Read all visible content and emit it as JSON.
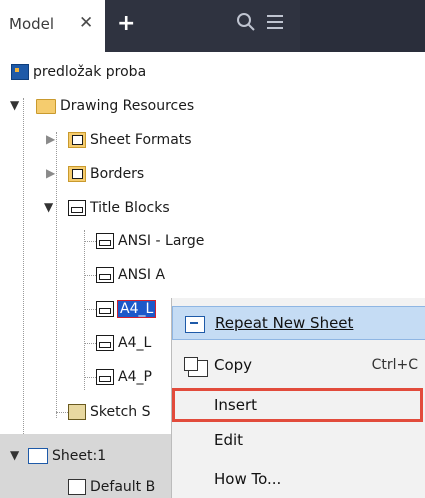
{
  "header": {
    "tab_label": "Model",
    "close_glyph": "✕",
    "add_glyph": "+",
    "search_icon": "search-icon",
    "menu_icon": "hamburger-menu-icon"
  },
  "tree": {
    "root": "predložak proba",
    "drawing_resources": "Drawing Resources",
    "sheet_formats": "Sheet Formats",
    "borders": "Borders",
    "title_blocks": "Title Blocks",
    "ansi_large": "ANSI - Large",
    "ansi_a": "ANSI A",
    "a4_l_selected": "A4_L",
    "a4_l2": "A4_L",
    "a4_p": "A4_P",
    "sketch_symbols": "Sketch S",
    "sheet1": "Sheet:1",
    "default_border": "Default B"
  },
  "context_menu": {
    "repeat_new_sheet": "Repeat New Sheet",
    "copy": "Copy",
    "copy_shortcut": "Ctrl+C",
    "insert": "Insert",
    "edit": "Edit",
    "how_to": "How To..."
  },
  "colors": {
    "selection": "#1c58c9",
    "highlight_box": "#e24b3c",
    "menu_hover": "#c5dcf4"
  }
}
